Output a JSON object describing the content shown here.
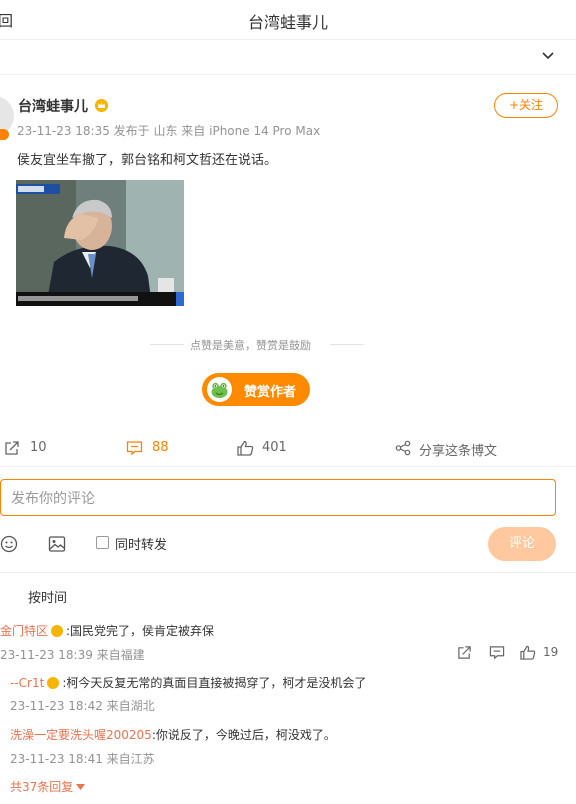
{
  "header": {
    "back_label": "回",
    "title": "台湾蛙事儿"
  },
  "post": {
    "author": "台湾蛙事儿",
    "meta": "23-11-23 18:35  发布于 山东  来自 iPhone 14 Pro Max",
    "follow_label": "+关注",
    "text": "侯友宜坐车撤了，郭台铭和柯文哲还在说话。",
    "reward_slogan": "点赞是美意，赞赏是鼓励",
    "reward_button": "赞赏作者"
  },
  "actions": {
    "repost_count": "10",
    "comment_count": "88",
    "like_count": "401",
    "share_label": "分享这条博文"
  },
  "comment_box": {
    "placeholder": "发布你的评论",
    "forward_label": "同时转发",
    "submit_label": "评论"
  },
  "comments": {
    "sort_label": "按时间",
    "first": {
      "user": "金门特区",
      "text": ":国民党完了，侯肯定被弃保",
      "meta": "23-11-23 18:39 来自福建",
      "like_count": "19"
    },
    "replies": [
      {
        "user": "--Cr1t",
        "text": ":柯今天反复无常的真面目直接被揭穿了，柯才是没机会了",
        "meta": "23-11-23 18:42 来自湖北"
      },
      {
        "user": "洗澡一定要洗头喔200205",
        "text": ":你说反了，今晚过后，柯没戏了。",
        "meta": "23-11-23 18:41 来自江苏"
      }
    ],
    "more_replies": "共37条回复"
  },
  "colors": {
    "accent": "#ff8200",
    "username_link": "#eb7350",
    "meta_gray": "#939393"
  },
  "icons": [
    "chevron-down-icon",
    "crown-badge-icon",
    "repost-icon",
    "comment-icon",
    "like-icon",
    "share-icon",
    "emoji-icon",
    "image-icon",
    "checkbox-icon",
    "caret-down-icon"
  ]
}
